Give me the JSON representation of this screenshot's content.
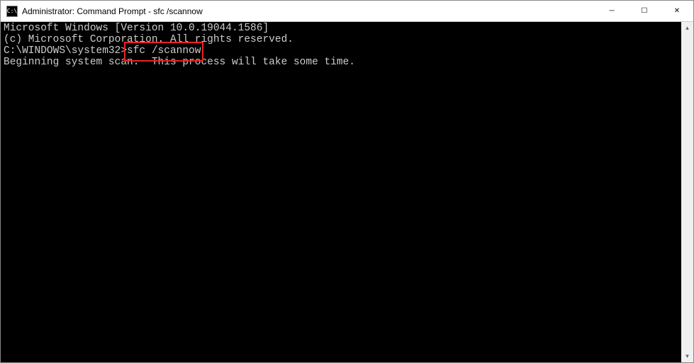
{
  "titlebar": {
    "icon_text": "C:\\",
    "title": "Administrator: Command Prompt - sfc  /scannow"
  },
  "window_controls": {
    "minimize": "─",
    "maximize": "☐",
    "close": "✕"
  },
  "terminal": {
    "line1": "Microsoft Windows [Version 10.0.19044.1586]",
    "line2": "(c) Microsoft Corporation. All rights reserved.",
    "blank1": "",
    "prompt": "C:\\WINDOWS\\system32>",
    "command": "sfc /scannow",
    "blank2": "",
    "line3": "Beginning system scan.  This process will take some time."
  },
  "scrollbar": {
    "up": "▴",
    "down": "▾"
  }
}
